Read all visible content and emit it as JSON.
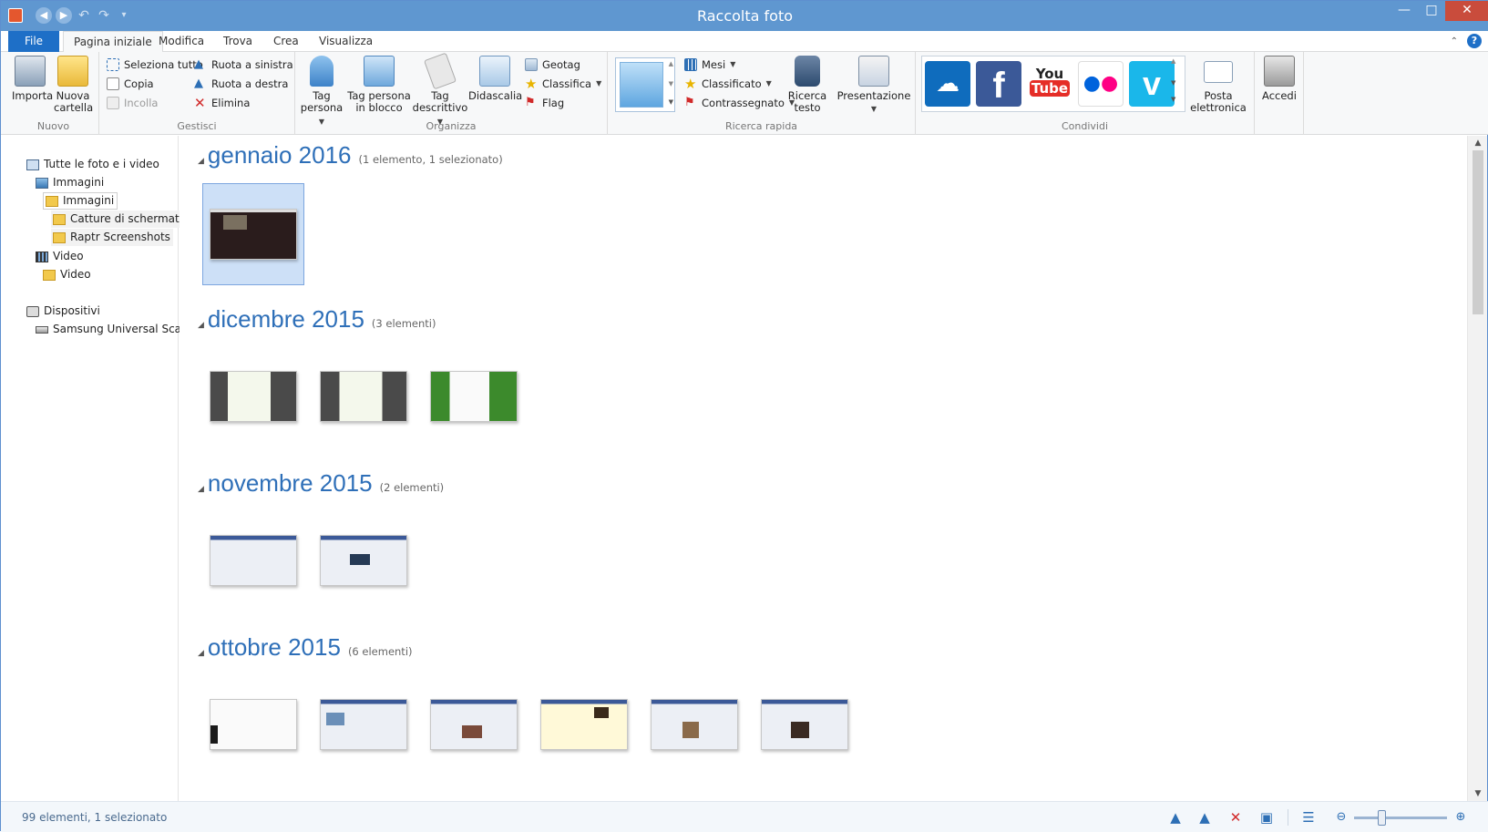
{
  "window": {
    "title": "Raccolta foto"
  },
  "colors": {
    "titlebar": "#5f97d0",
    "accent": "#1e6fc7",
    "group_title": "#2e6fb8",
    "close": "#c94c3c"
  },
  "tabs": {
    "file": "File",
    "items": [
      "Pagina iniziale",
      "Modifica",
      "Trova",
      "Crea",
      "Visualizza"
    ]
  },
  "ribbon": {
    "nuovo": {
      "label": "Nuovo",
      "importa": "Importa",
      "nuova": "Nuova",
      "cartella": "cartella"
    },
    "gestisci": {
      "label": "Gestisci",
      "seleziona": "Seleziona tutto",
      "copia": "Copia",
      "incolla": "Incolla",
      "ruota_sx": "Ruota a sinistra",
      "ruota_dx": "Ruota a destra",
      "elimina": "Elimina"
    },
    "organizza": {
      "label": "Organizza",
      "tag_persona_1": "Tag",
      "tag_persona_2": "persona",
      "tag_blocco_1": "Tag persona",
      "tag_blocco_2": "in blocco",
      "tag_desc_1": "Tag",
      "tag_desc_2": "descrittivo",
      "didascalia": "Didascalia",
      "geotag": "Geotag",
      "classifica": "Classifica",
      "flag": "Flag"
    },
    "ricerca": {
      "label": "Ricerca rapida",
      "mesi": "Mesi",
      "classificato": "Classificato",
      "contrassegnato": "Contrassegnato",
      "ricerca_1": "Ricerca",
      "ricerca_2": "testo",
      "presentazione": "Presentazione"
    },
    "condividi": {
      "label": "Condividi",
      "youtube_1": "You",
      "youtube_2": "Tube",
      "posta_1": "Posta",
      "posta_2": "elettronica"
    },
    "accedi": "Accedi"
  },
  "nav": {
    "all": "Tutte le foto e i video",
    "immagini_root": "Immagini",
    "immagini_sub": "Immagini",
    "catture": "Catture di schermata",
    "raptr": "Raptr Screenshots",
    "video_root": "Video",
    "video_sub": "Video",
    "dispositivi": "Dispositivi",
    "samsung": "Samsung Universal Scan"
  },
  "groups": [
    {
      "title": "gennaio 2016",
      "count": "(1 elemento, 1 selezionato)"
    },
    {
      "title": "dicembre 2015",
      "count": "(3 elementi)"
    },
    {
      "title": "novembre 2015",
      "count": "(2 elementi)"
    },
    {
      "title": "ottobre 2015",
      "count": "(6 elementi)"
    }
  ],
  "status": {
    "text": "99 elementi, 1 selezionato",
    "zoom_level": 0.28
  }
}
